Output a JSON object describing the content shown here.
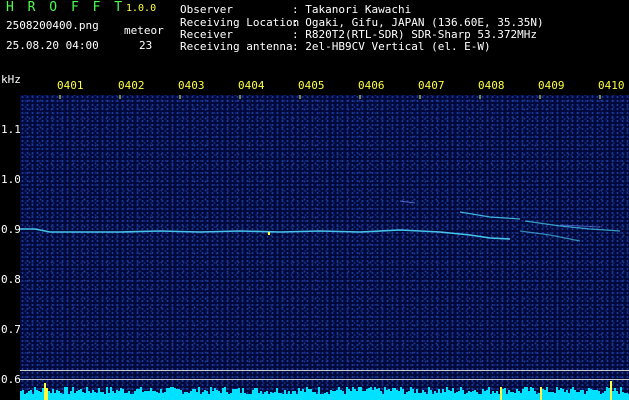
{
  "header": {
    "app_title": "H R O F F T",
    "app_version": "1.0.0",
    "file_name": "2508200400.png",
    "timestamp": "25.08.20 04:00",
    "meteor_label": "meteor",
    "meteor_count": "23"
  },
  "info": [
    {
      "label": "Observer",
      "value": ": Takanori Kawachi"
    },
    {
      "label": "Receiving Location",
      "value": ": Ogaki, Gifu, JAPAN (136.60E, 35.35N)"
    },
    {
      "label": "Receiver",
      "value": ": R820T2(RTL-SDR) SDR-Sharp 53.372MHz"
    },
    {
      "label": "Receiving antenna",
      "value": ": 2el-HB9CV Vertical (el. E-W)"
    }
  ],
  "axis": {
    "unit": "kHz",
    "y_ticks": [
      "1.1",
      "1.0",
      "0.9",
      "0.8",
      "0.7",
      "0.6"
    ],
    "x_ticks": [
      "0401",
      "0402",
      "0403",
      "0404",
      "0405",
      "0406",
      "0407",
      "0408",
      "0409",
      "0410"
    ]
  },
  "colors": {
    "background": "#000000",
    "waterfall": "#00093a",
    "carrier": "#4fd8ff",
    "label_green": "#4cff4c",
    "label_yellow": "#ffff40",
    "signal_bars": "#00e0ff",
    "signal_peaks": "#ffff40"
  }
}
